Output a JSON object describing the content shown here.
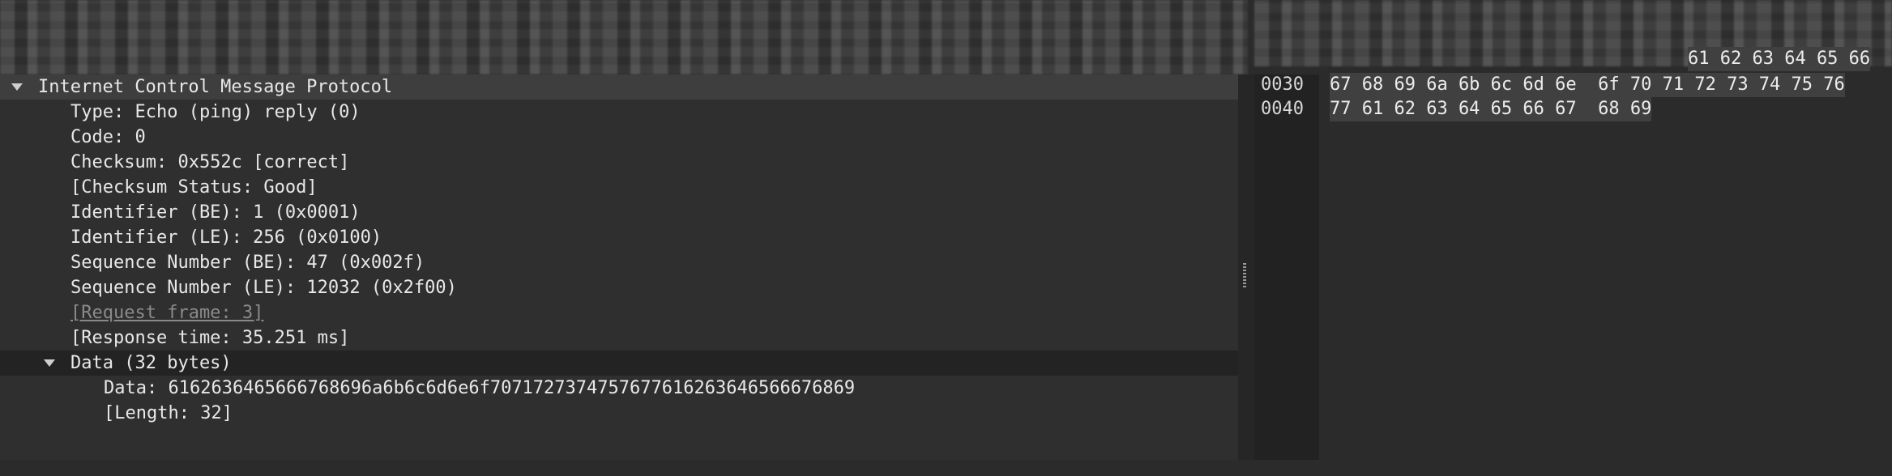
{
  "packet_details": {
    "protocol_header": "Internet Control Message Protocol",
    "fields": [
      "Type: Echo (ping) reply (0)",
      "Code: 0",
      "Checksum: 0x552c [correct]",
      "[Checksum Status: Good]",
      "Identifier (BE): 1 (0x0001)",
      "Identifier (LE): 256 (0x0100)",
      "Sequence Number (BE): 47 (0x002f)",
      "Sequence Number (LE): 12032 (0x2f00)",
      "[Request frame: 3]",
      "[Response time: 35.251 ms]"
    ],
    "data_header": "Data (32 bytes)",
    "data_fields": [
      "Data: 6162636465666768696a6b6c6d6e6f7071727374757677616263646566676869",
      "[Length: 32]"
    ]
  },
  "hex_dump": {
    "top_partial": "61 62 63 64 65 66",
    "rows": [
      {
        "offset": "0030",
        "bytes": "67 68 69 6a 6b 6c 6d 6e  6f 70 71 72 73 74 75 76"
      },
      {
        "offset": "0040",
        "bytes": "77 61 62 63 64 65 66 67  68 69"
      }
    ]
  }
}
